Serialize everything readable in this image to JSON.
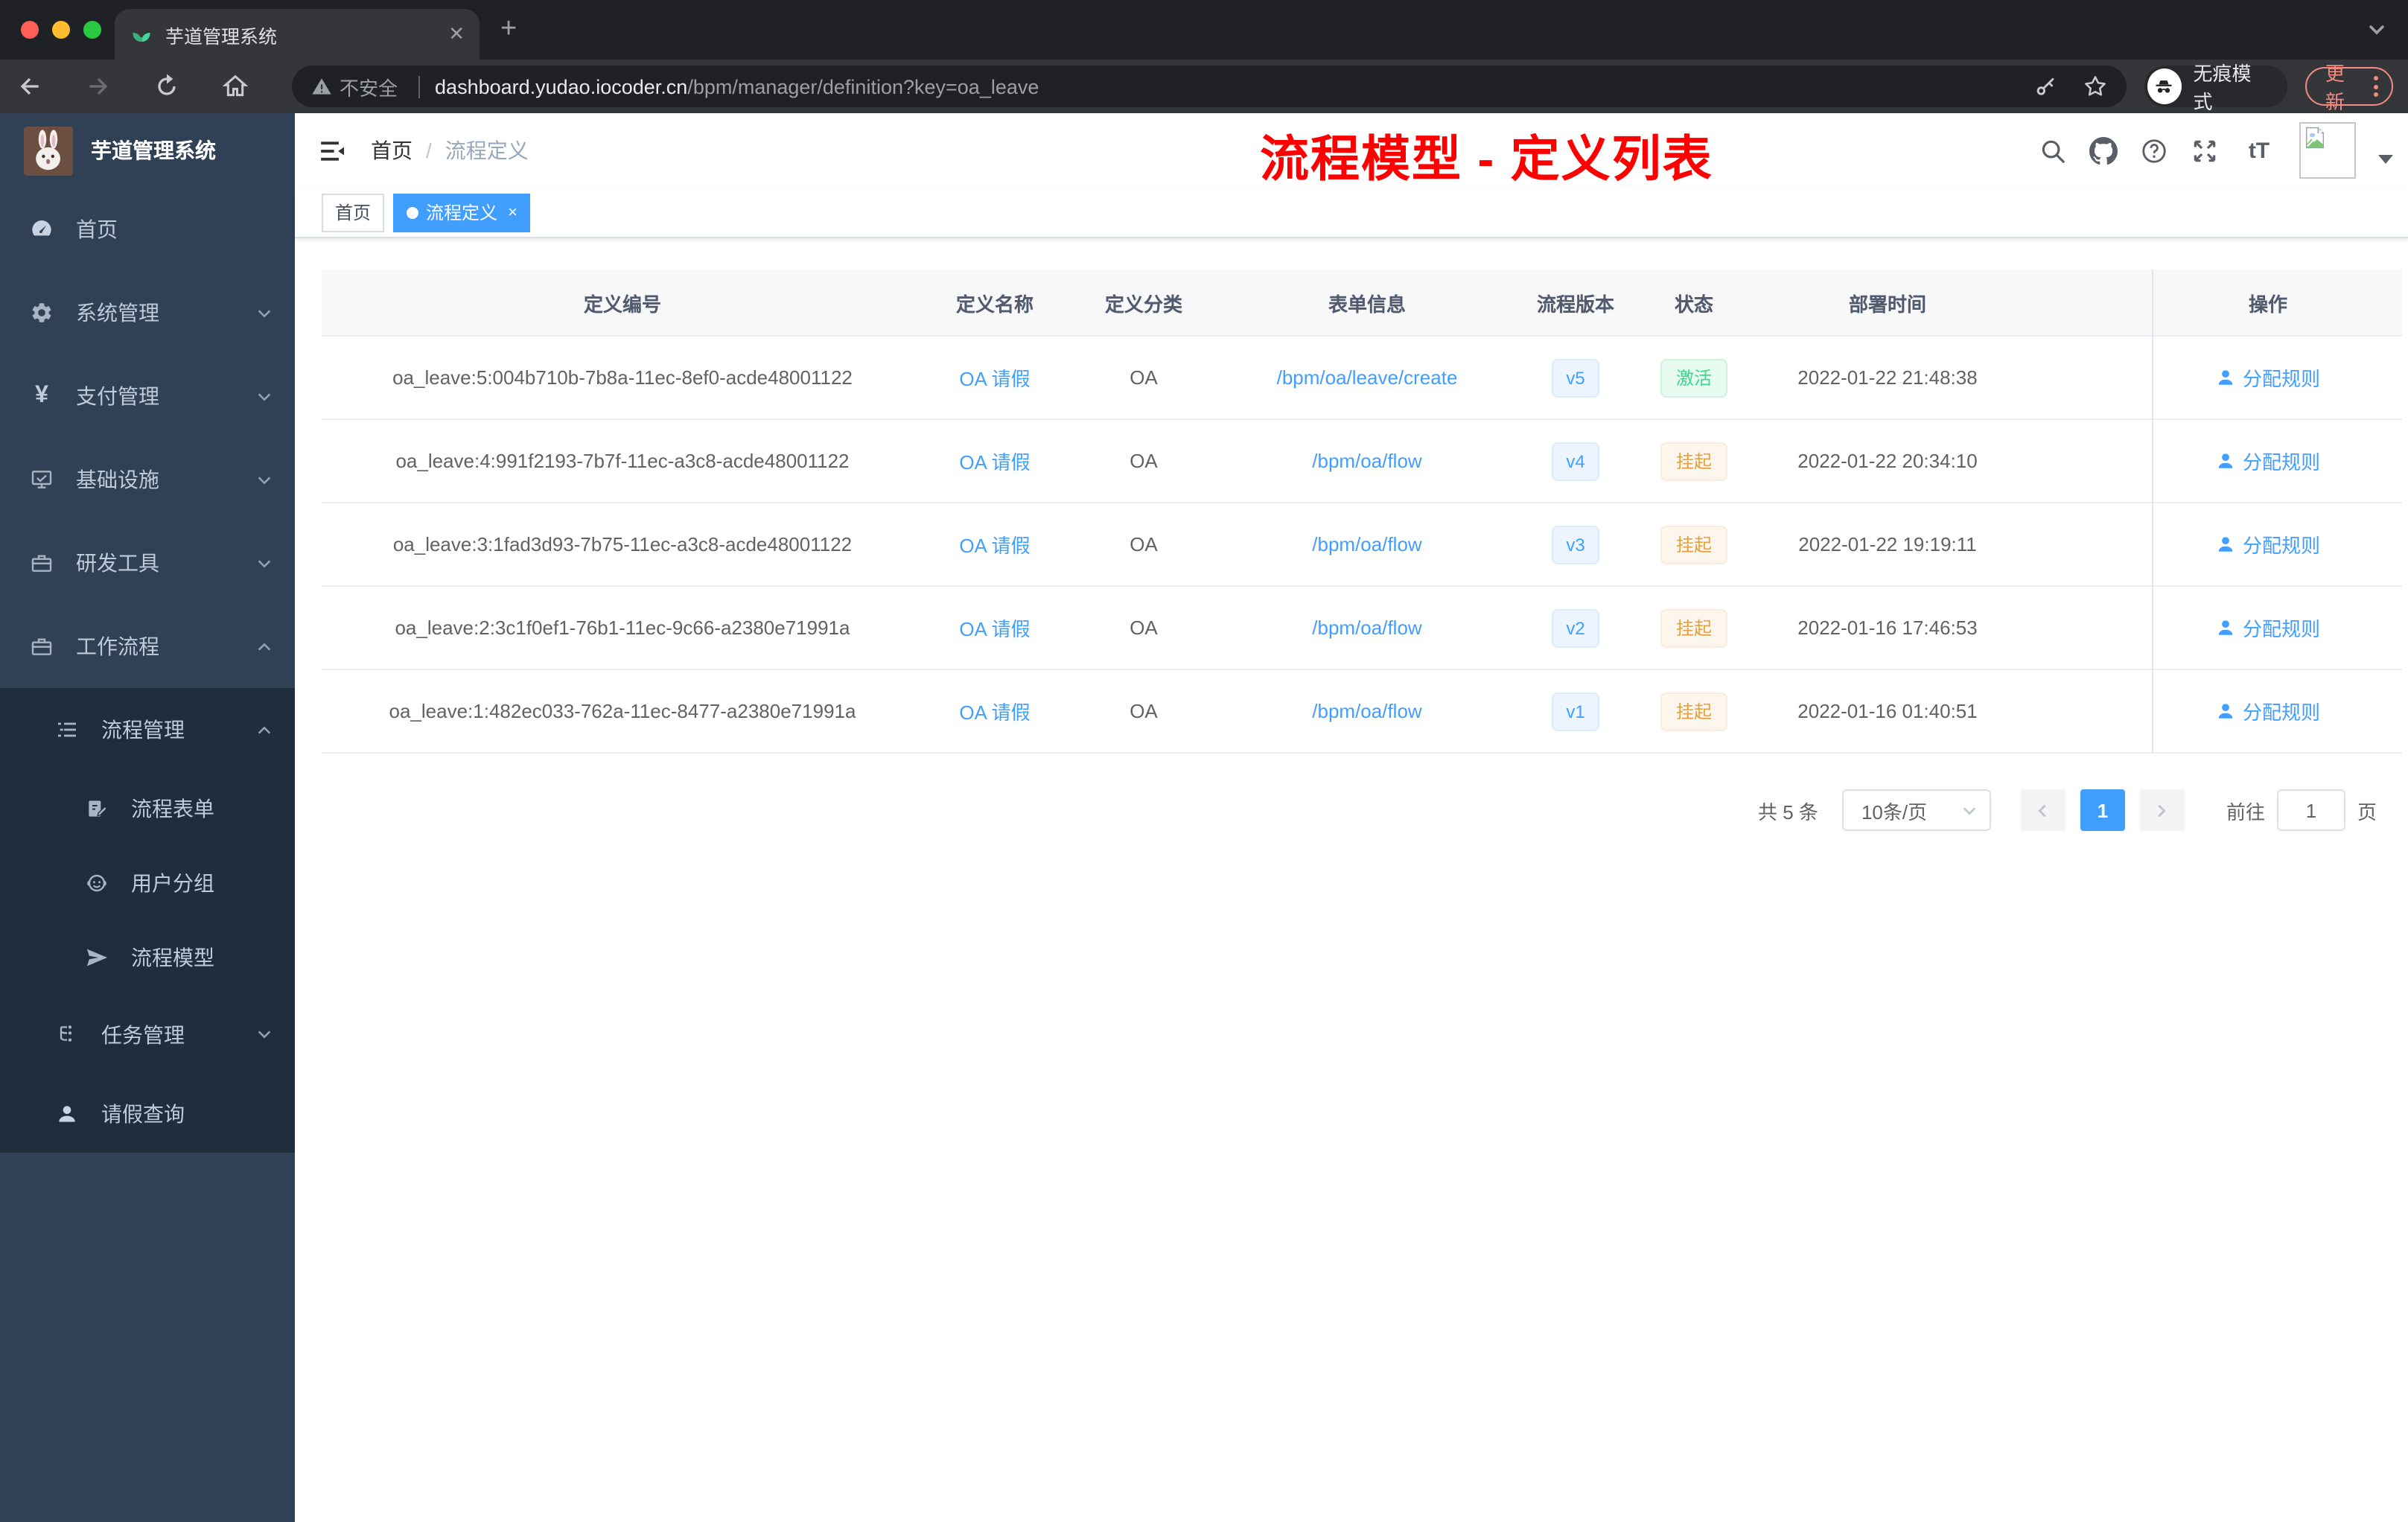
{
  "browser": {
    "tab": {
      "title": "芋道管理系统",
      "close_glyph": "✕",
      "new_tab_glyph": "+"
    },
    "address": {
      "security_label": "不安全",
      "domain": "dashboard.yudao.iocoder.cn",
      "path": "/bpm/manager/definition?key=oa_leave"
    },
    "incognito_label": "无痕模式",
    "update_label": "更新"
  },
  "sidebar": {
    "logo_title": "芋道管理系统",
    "items": [
      {
        "label": "首页"
      },
      {
        "label": "系统管理"
      },
      {
        "label": "支付管理"
      },
      {
        "label": "基础设施"
      },
      {
        "label": "研发工具"
      },
      {
        "label": "工作流程"
      },
      {
        "label": "流程管理"
      },
      {
        "label": "流程表单"
      },
      {
        "label": "用户分组"
      },
      {
        "label": "流程模型"
      },
      {
        "label": "任务管理"
      },
      {
        "label": "请假查询"
      }
    ],
    "yen_glyph": "¥"
  },
  "navbar": {
    "breadcrumb": {
      "home": "首页",
      "separator": "/",
      "current": "流程定义"
    },
    "annotation": "流程模型 - 定义列表"
  },
  "tags": {
    "home": "首页",
    "active": "流程定义",
    "close_glyph": "×"
  },
  "table": {
    "columns": [
      "定义编号",
      "定义名称",
      "定义分类",
      "表单信息",
      "流程版本",
      "状态",
      "部署时间",
      "操作"
    ],
    "action_label": "分配规则",
    "rows": [
      {
        "id": "oa_leave:5:004b710b-7b8a-11ec-8ef0-acde48001122",
        "name": "OA 请假",
        "category": "OA",
        "form": "/bpm/oa/leave/create",
        "version": "v5",
        "status": "激活",
        "time": "2022-01-22 21:48:38"
      },
      {
        "id": "oa_leave:4:991f2193-7b7f-11ec-a3c8-acde48001122",
        "name": "OA 请假",
        "category": "OA",
        "form": "/bpm/oa/flow",
        "version": "v4",
        "status": "挂起",
        "time": "2022-01-22 20:34:10"
      },
      {
        "id": "oa_leave:3:1fad3d93-7b75-11ec-a3c8-acde48001122",
        "name": "OA 请假",
        "category": "OA",
        "form": "/bpm/oa/flow",
        "version": "v3",
        "status": "挂起",
        "time": "2022-01-22 19:19:11"
      },
      {
        "id": "oa_leave:2:3c1f0ef1-76b1-11ec-9c66-a2380e71991a",
        "name": "OA 请假",
        "category": "OA",
        "form": "/bpm/oa/flow",
        "version": "v2",
        "status": "挂起",
        "time": "2022-01-16 17:46:53"
      },
      {
        "id": "oa_leave:1:482ec033-762a-11ec-8477-a2380e71991a",
        "name": "OA 请假",
        "category": "OA",
        "form": "/bpm/oa/flow",
        "version": "v1",
        "status": "挂起",
        "time": "2022-01-16 01:40:51"
      }
    ]
  },
  "pagination": {
    "total": "共 5 条",
    "page_size": "10条/页",
    "current": "1",
    "goto": "前往",
    "goto_value": "1",
    "page_unit": "页"
  },
  "colors": {
    "accent": "#409eff",
    "success": "#3dd68c",
    "warning": "#e6a23c",
    "annotation": "#fe0000"
  }
}
